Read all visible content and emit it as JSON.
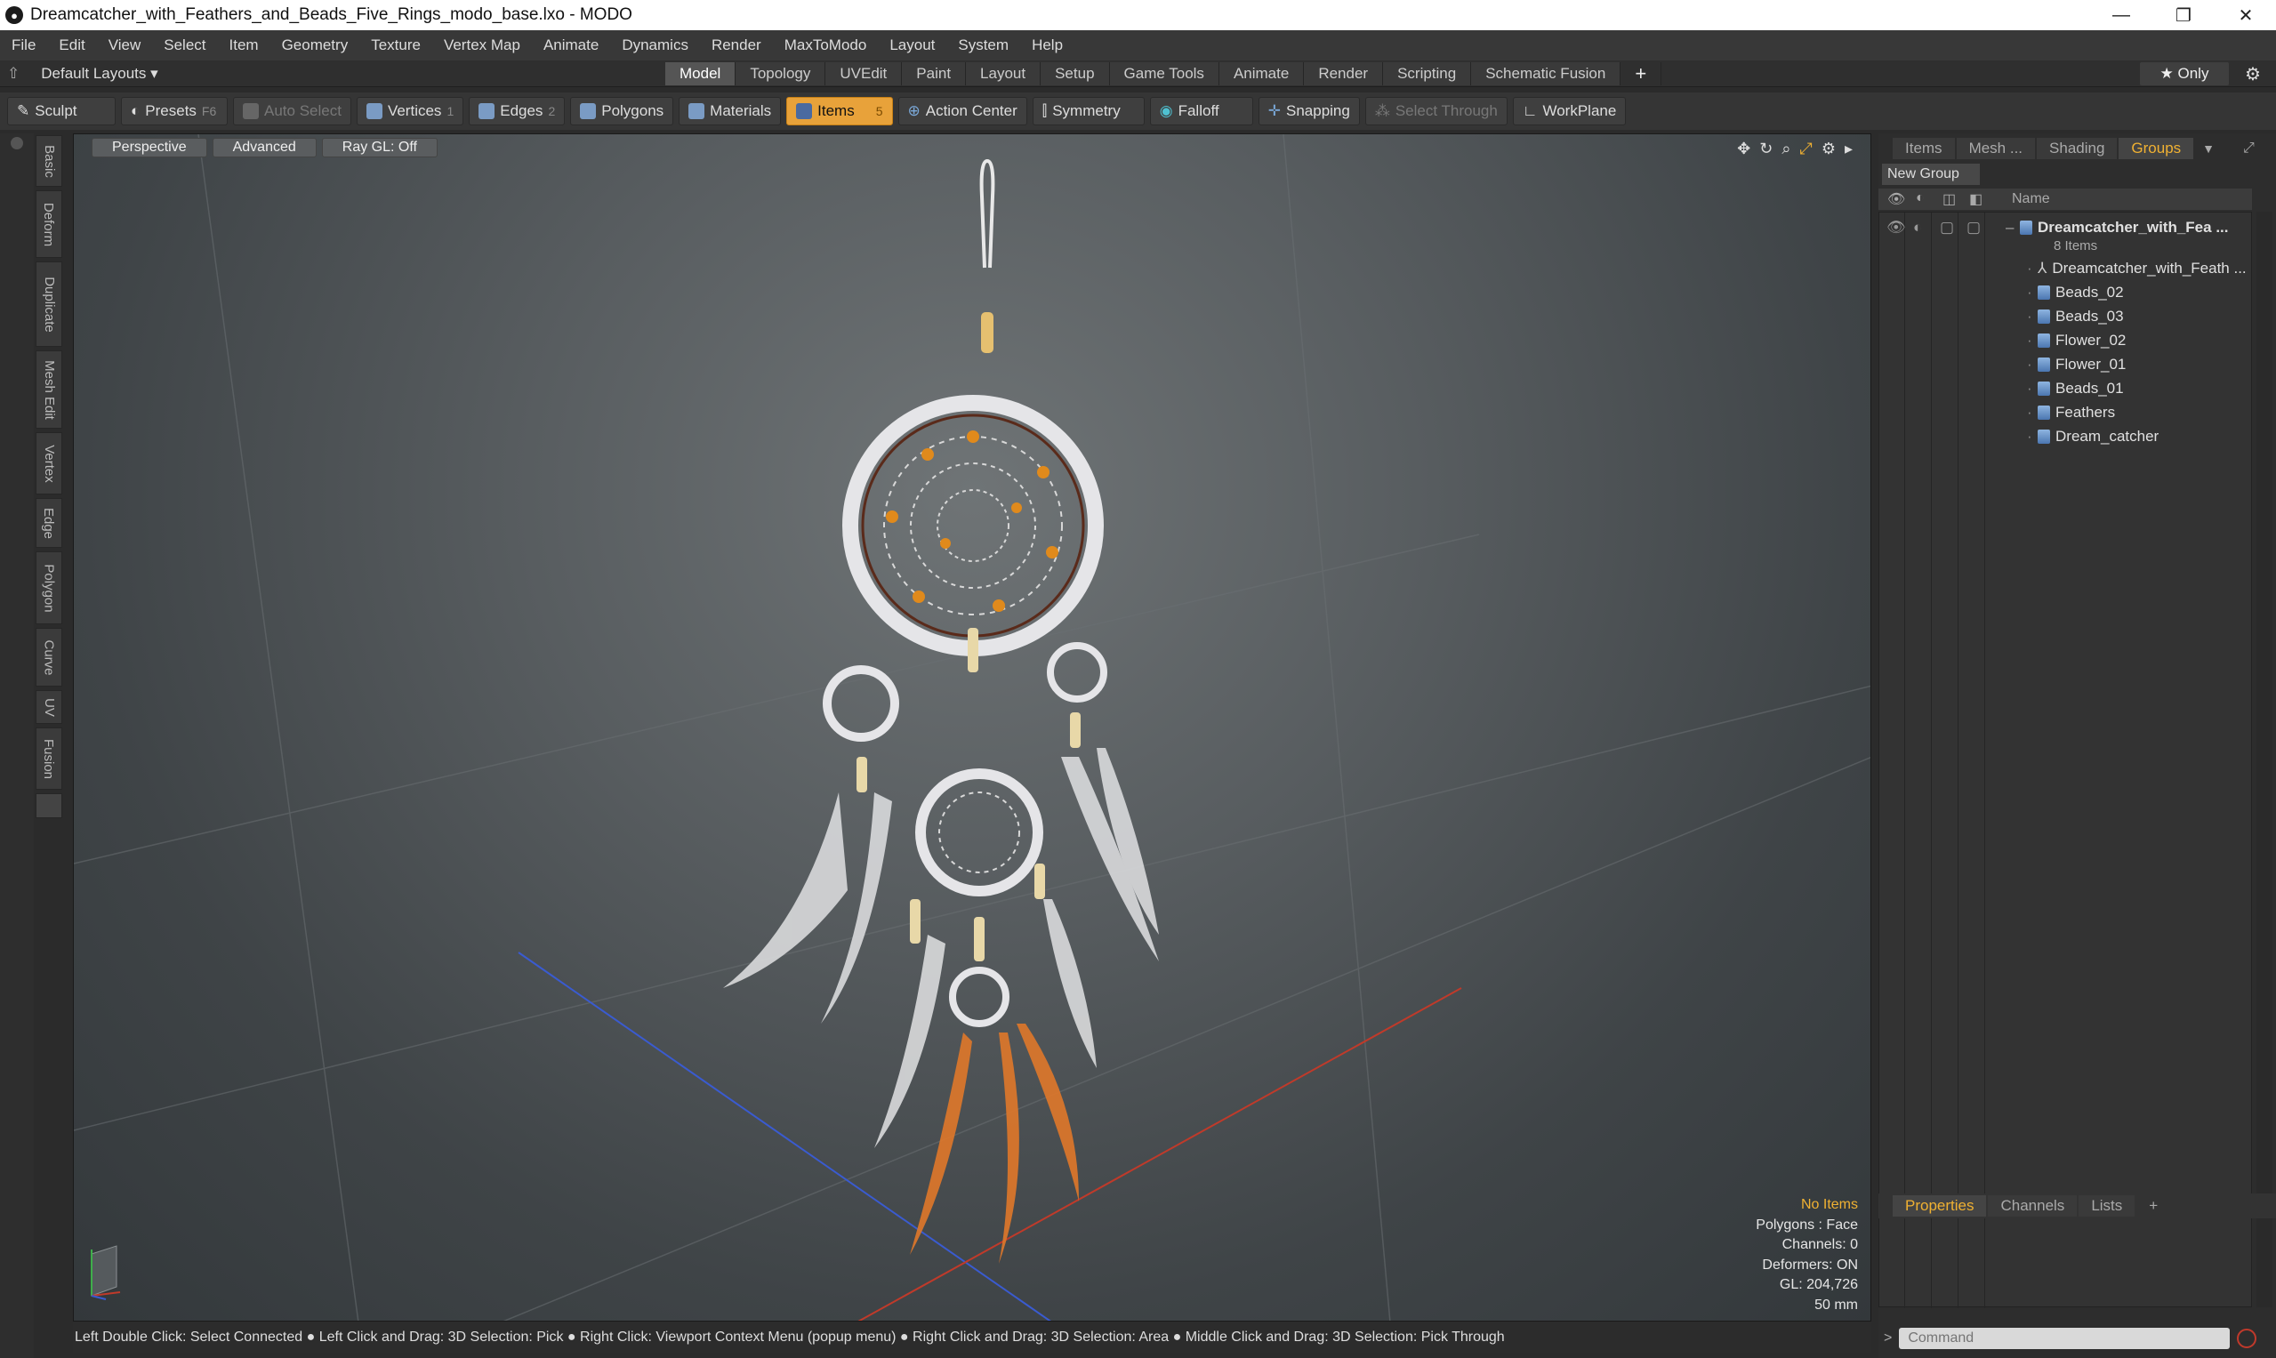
{
  "window": {
    "title": "Dreamcatcher_with_Feathers_and_Beads_Five_Rings_modo_base.lxo - MODO",
    "minimize": "—",
    "restore": "❐",
    "close": "✕"
  },
  "menu": [
    "File",
    "Edit",
    "View",
    "Select",
    "Item",
    "Geometry",
    "Texture",
    "Vertex Map",
    "Animate",
    "Dynamics",
    "Render",
    "MaxToModo",
    "Layout",
    "System",
    "Help"
  ],
  "layouts": {
    "label": "Default Layouts ▾"
  },
  "tabs": [
    {
      "label": "Model",
      "active": true
    },
    {
      "label": "Topology"
    },
    {
      "label": "UVEdit"
    },
    {
      "label": "Paint"
    },
    {
      "label": "Layout"
    },
    {
      "label": "Setup"
    },
    {
      "label": "Game Tools"
    },
    {
      "label": "Animate"
    },
    {
      "label": "Render"
    },
    {
      "label": "Scripting"
    },
    {
      "label": "Schematic Fusion"
    }
  ],
  "tabs_plus": "+",
  "only": "★  Only",
  "toolbar": {
    "sculpt": "Sculpt",
    "presets": "Presets",
    "presets_key": "F6",
    "auto_select": "Auto Select",
    "vertices": "Vertices",
    "vertices_key": "1",
    "edges": "Edges",
    "edges_key": "2",
    "polygons": "Polygons",
    "materials": "Materials",
    "items": "Items",
    "items_key": "5",
    "action_center": "Action Center",
    "symmetry": "Symmetry",
    "falloff": "Falloff",
    "snapping": "Snapping",
    "select_through": "Select Through",
    "workplane": "WorkPlane"
  },
  "left_tabs": [
    "Basic",
    "Deform",
    "Duplicate",
    "Mesh Edit",
    "Vertex",
    "Edge",
    "Polygon",
    "Curve",
    "UV",
    "Fusion"
  ],
  "viewport": {
    "view": "Perspective",
    "shading": "Advanced",
    "raygl": "Ray GL: Off",
    "info": {
      "selection": "No Items",
      "polygons": "Polygons : Face",
      "channels": "Channels: 0",
      "deformers": "Deformers: ON",
      "gl": "GL: 204,726",
      "units": "50 mm"
    }
  },
  "status": "Left Double Click: Select Connected ● Left Click and Drag: 3D Selection: Pick ● Right Click: Viewport Context Menu (popup menu) ● Right Click and Drag: 3D Selection: Area ● Middle Click and Drag: 3D Selection: Pick Through",
  "right_panel": {
    "tabs": [
      {
        "label": "Items"
      },
      {
        "label": "Mesh ..."
      },
      {
        "label": "Shading"
      },
      {
        "label": "Groups",
        "active": true
      }
    ],
    "new_group": "New Group",
    "column_name": "Name",
    "group": {
      "name": "Dreamcatcher_with_Fea ...",
      "count": "8 Items"
    },
    "items": [
      "Dreamcatcher_with_Feath ...",
      "Beads_02",
      "Beads_03",
      "Flower_02",
      "Flower_01",
      "Beads_01",
      "Feathers",
      "Dream_catcher"
    ],
    "bottom_tabs": [
      {
        "label": "Properties",
        "active": true
      },
      {
        "label": "Channels"
      },
      {
        "label": "Lists"
      },
      {
        "label": "+"
      }
    ],
    "command_placeholder": "Command"
  },
  "colors": {
    "accent": "#f0b132",
    "active_tool": "#e8a23a"
  }
}
